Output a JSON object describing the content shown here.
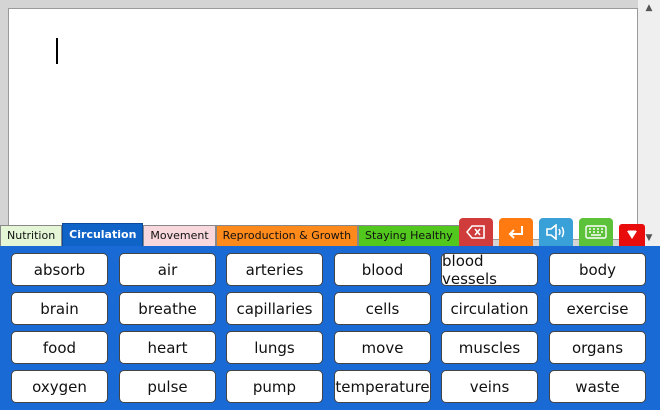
{
  "tabs": [
    {
      "label": "Nutrition",
      "bg": "#e4f6d6",
      "active": false
    },
    {
      "label": "Circulation",
      "bg": "#1064c8",
      "active": true
    },
    {
      "label": "Movement",
      "bg": "#f8d8dc",
      "active": false
    },
    {
      "label": "Reproduction & Growth",
      "bg": "#ff8a1c",
      "active": false
    },
    {
      "label": "Staying Healthy",
      "bg": "#52c81e",
      "active": false
    }
  ],
  "toolbar": {
    "backspace": {
      "icon": "backspace-icon",
      "color": "#d03c3c"
    },
    "enter": {
      "icon": "enter-icon",
      "color": "#ff7a10"
    },
    "speak": {
      "icon": "speaker-icon",
      "color": "#3aa0d8"
    },
    "keyboard": {
      "icon": "keyboard-icon",
      "color": "#5cc23a"
    },
    "collapse": {
      "icon": "down-arrow-icon",
      "color": "#e80c0c"
    }
  },
  "words": [
    [
      "absorb",
      "air",
      "arteries",
      "blood",
      "blood vessels",
      "body"
    ],
    [
      "brain",
      "breathe",
      "capillaries",
      "cells",
      "circulation",
      "exercise"
    ],
    [
      "food",
      "heart",
      "lungs",
      "move",
      "muscles",
      "organs"
    ],
    [
      "oxygen",
      "pulse",
      "pump",
      "temperature",
      "veins",
      "waste"
    ]
  ]
}
